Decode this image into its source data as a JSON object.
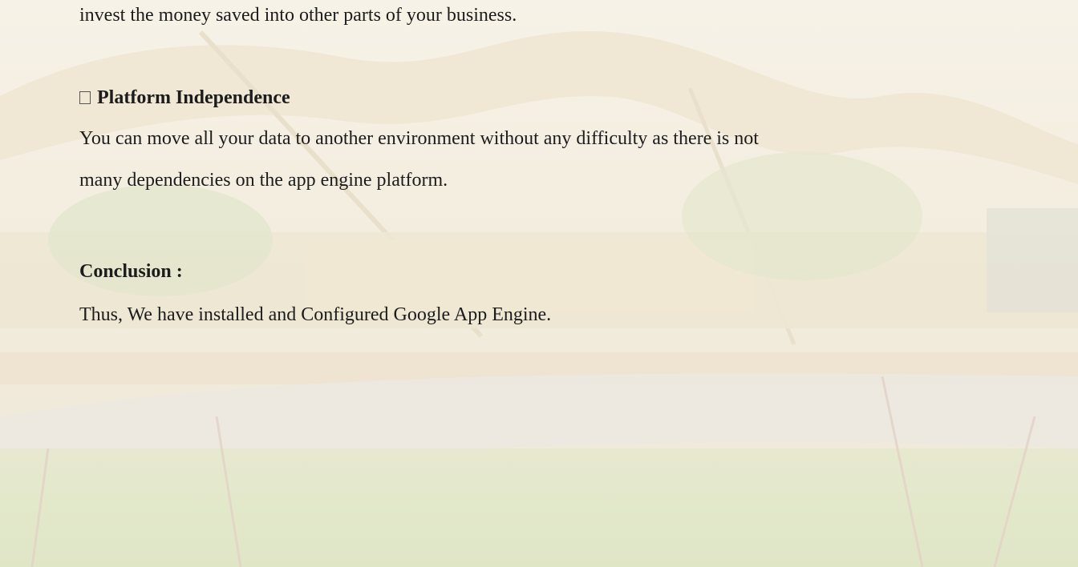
{
  "document": {
    "line_intro": "invest the money saved into other parts of your business.",
    "section_heading": "Platform Independence",
    "para_line_1": "You can move all your data to another environment without any difficulty as there is not",
    "para_line_2": "many dependencies on the app engine platform.",
    "conclusion_heading": "Conclusion :",
    "conclusion_text": "Thus, We have installed and Configured Google App Engine."
  },
  "colors": {
    "text": "#1c1c1c",
    "background": "#f6f1e6"
  },
  "icons": {
    "bullet": "checkbox-square-icon"
  }
}
